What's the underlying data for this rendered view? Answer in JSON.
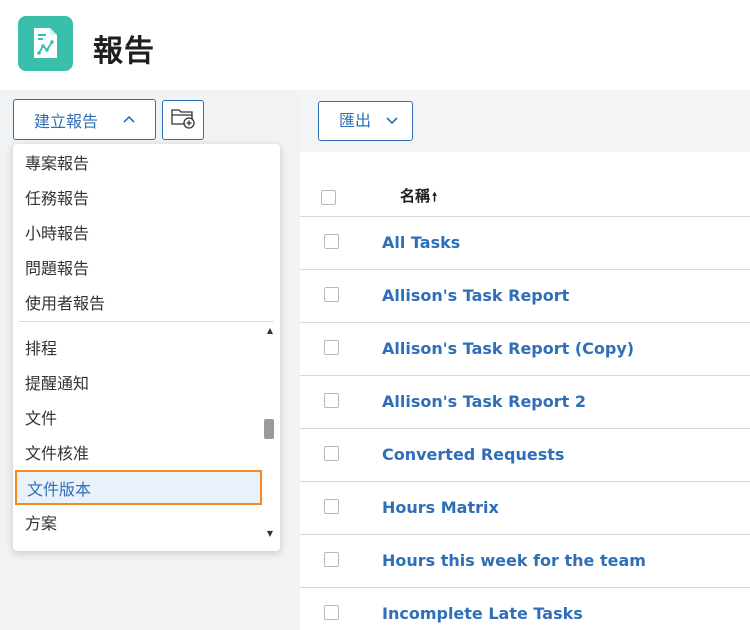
{
  "header": {
    "title": "報告",
    "icon": "report-chart-icon",
    "accent": "#3bbfad"
  },
  "left_panel": {
    "create_button_label": "建立報告",
    "create_button_icon": "chevron-up-icon",
    "folder_button_icon": "add-folder-icon",
    "dropdown": {
      "group1": [
        "專案報告",
        "任務報告",
        "小時報告",
        "問題報告",
        "使用者報告"
      ],
      "group2": [
        "排程",
        "提醒通知",
        "文件",
        "文件核准",
        "文件版本",
        "方案"
      ],
      "selected": "文件版本",
      "highlight_color": "#f28a1e"
    }
  },
  "main": {
    "export_button_label": "匯出",
    "export_button_icon": "chevron-down-icon",
    "table": {
      "column_name": "名稱",
      "sort_icon": "sort-ascending-arrow-icon",
      "rows": [
        "All Tasks",
        "Allison's Task Report",
        "Allison's Task Report (Copy)",
        "Allison's Task Report 2",
        "Converted Requests",
        "Hours Matrix",
        "Hours this week for the team",
        "Incomplete Late Tasks"
      ]
    },
    "link_color": "#2f6fb8"
  }
}
